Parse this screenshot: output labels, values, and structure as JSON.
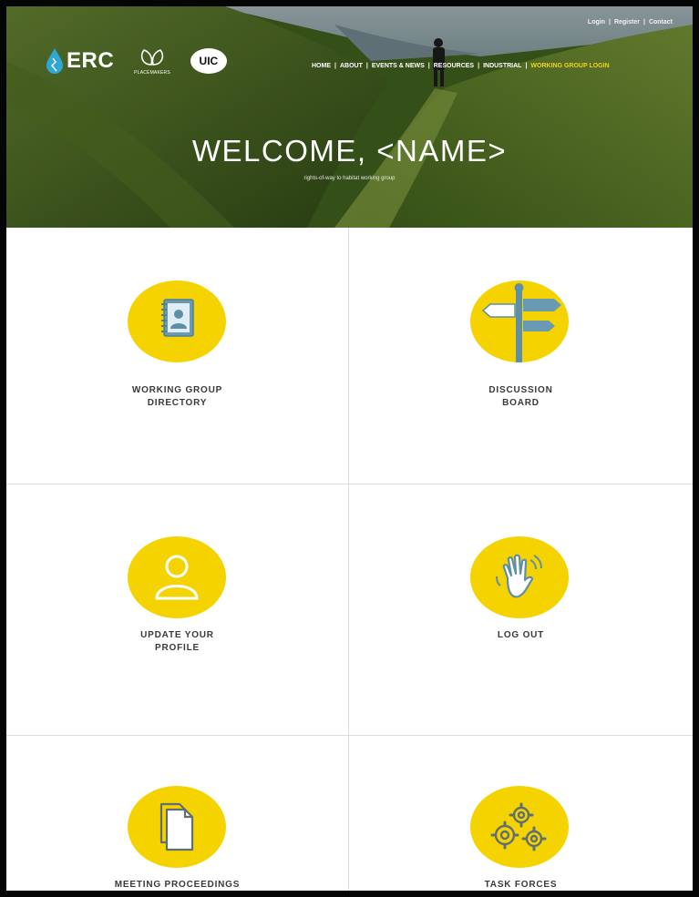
{
  "header": {
    "top_links": [
      "Login",
      "Register",
      "Contact"
    ],
    "logos": {
      "erc": "ERC",
      "leaf_caption": "PLACEMAKERS",
      "uic": "UIC"
    },
    "nav": [
      "HOME",
      "ABOUT",
      "EVENTS & NEWS",
      "RESOURCES",
      "INDUSTRIAL",
      "WORKING GROUP LOGIN"
    ],
    "welcome": "WELCOME, <NAME>",
    "subtitle": "rights-of-way to habitat working group"
  },
  "tiles": [
    {
      "label_line1": "WORKING GROUP",
      "label_line2": "DIRECTORY",
      "icon": "contact-book-icon"
    },
    {
      "label_line1": "DISCUSSION",
      "label_line2": "BOARD",
      "icon": "signpost-icon"
    },
    {
      "label_line1": "UPDATE YOUR",
      "label_line2": "PROFILE",
      "icon": "user-icon"
    },
    {
      "label_line1": "LOG OUT",
      "label_line2": "",
      "icon": "waving-hand-icon"
    },
    {
      "label_line1": "MEETING PROCEEDINGS",
      "label_line2": "",
      "icon": "documents-icon"
    },
    {
      "label_line1": "TASK FORCES",
      "label_line2": "",
      "icon": "gears-icon"
    }
  ],
  "colors": {
    "accent_yellow": "#f5d300",
    "icon_blue": "#5f8fa6",
    "active_nav": "#f1d21c"
  }
}
